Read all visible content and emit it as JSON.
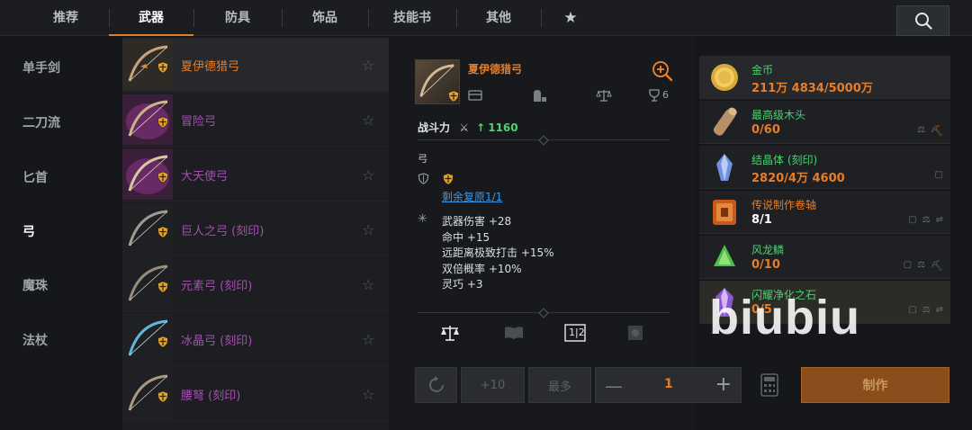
{
  "tabs": [
    {
      "label": "推荐"
    },
    {
      "label": "武器"
    },
    {
      "label": "防具"
    },
    {
      "label": "饰品"
    },
    {
      "label": "技能书"
    },
    {
      "label": "其他"
    }
  ],
  "categories": [
    "单手剑",
    "二刀流",
    "匕首",
    "弓",
    "魔珠",
    "法杖"
  ],
  "items": [
    {
      "name": "夏伊德猎弓",
      "tone": "orange"
    },
    {
      "name": "冒险弓",
      "tone": "purple"
    },
    {
      "name": "大天使弓",
      "tone": "purple"
    },
    {
      "name": "巨人之弓 (刻印)",
      "tone": "purple"
    },
    {
      "name": "元素弓 (刻印)",
      "tone": "purple"
    },
    {
      "name": "冰晶弓 (刻印)",
      "tone": "purple"
    },
    {
      "name": "腰弩 (刻印)",
      "tone": "purple"
    }
  ],
  "detail": {
    "title": "夏伊德猎弓",
    "icon_count": "6",
    "power_label": "战斗力",
    "power_value": "1160",
    "type": "弓",
    "restore": "剩余复原1/1",
    "stats": [
      "武器伤害 +28",
      "命中 +15",
      "远距离极致打击 +15%",
      "双倍概率 +10%",
      "灵巧 +3"
    ],
    "split_label": "1|2"
  },
  "materials": [
    {
      "name": "金币",
      "count": "211万 4834/5000万",
      "name_color": "green",
      "count_color": "orange"
    },
    {
      "name": "最高级木头",
      "count": "0/60",
      "name_color": "green",
      "count_color": "orange"
    },
    {
      "name": "结晶体 (刻印)",
      "count": "2820/4万 4600",
      "name_color": "green",
      "count_color": "orange"
    },
    {
      "name": "传说制作卷轴",
      "count": "8/1",
      "name_color": "orange",
      "count_color": "white"
    },
    {
      "name": "风龙鳞",
      "count": "0/10",
      "name_color": "green",
      "count_color": "orange"
    },
    {
      "name": "闪耀净化之石",
      "count": "0/5",
      "name_color": "green",
      "count_color": "orange"
    }
  ],
  "controls": {
    "plus10": "+10",
    "max": "最多",
    "quantity": "1",
    "craft": "制作"
  },
  "watermark": "biubiu",
  "colors": {
    "accent": "#e57e2a",
    "green": "#4cd173",
    "purple": "#a64fb2",
    "link": "#3a97e4"
  }
}
